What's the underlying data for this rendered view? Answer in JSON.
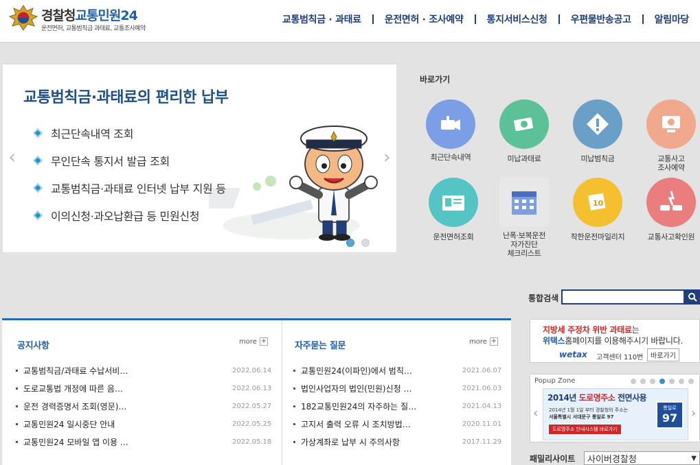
{
  "header": {
    "logo_title_a": "경찰청",
    "logo_title_b": "교통민원24",
    "logo_sub": "운전면허, 교통범칙금 과태료, 교통조사예약",
    "nav": [
      "교통범칙금 · 과태료",
      "운전면허 · 조사예약",
      "통지서비스신청",
      "우편물반송공고",
      "알림마당"
    ]
  },
  "slider": {
    "title": "교통범칙금·과태료의 편리한 납부",
    "items": [
      "최근단속내역 조회",
      "무인단속 통지서 발급 조회",
      "교통범칙금·과태료 인터넷 납부 지원 등",
      "이의신청·과오납환급 등 민원신청"
    ],
    "prev": "‹",
    "next": "›",
    "active_slide": 1,
    "slide_count": 2
  },
  "quick": {
    "title": "바로가기",
    "row1": [
      {
        "label": "최근단속내역",
        "color": "#7b9ee6",
        "icon": "camera-icon"
      },
      {
        "label": "미납과태료",
        "color": "#5cc196",
        "icon": "money-icon"
      },
      {
        "label": "미납범칙금",
        "color": "#6aa0c8",
        "icon": "warning-icon"
      },
      {
        "label": "교통사고\n조사예약",
        "color": "#f0a98c",
        "icon": "monitor-icon"
      }
    ],
    "row2": [
      {
        "label": "운전면허조회",
        "color": "#55c4c4",
        "icon": "license-icon"
      },
      {
        "label": "난폭·보복운전\n자가진단\n체크리스트",
        "color": "#7e9ee0",
        "icon": "calendar-icon"
      },
      {
        "label": "착한운전마일리지",
        "color": "#f5c030",
        "icon": "mileage-icon"
      },
      {
        "label": "교통사고확인원",
        "color": "#ea7e7e",
        "icon": "crash-icon"
      }
    ]
  },
  "search": {
    "label": "통합검색",
    "value": ""
  },
  "notice": {
    "title": "공지사항",
    "more": "more",
    "rows": [
      {
        "subject": "교통범칙금/과태료 수납서비…",
        "date": "2022.06.14"
      },
      {
        "subject": "도로교통법 개정에 따른 음…",
        "date": "2022.06.13"
      },
      {
        "subject": "운전 경력증명서 조회(영문)…",
        "date": "2022.05.27"
      },
      {
        "subject": "교통민원24 일시중단 안내",
        "date": "2022.05.25"
      },
      {
        "subject": "교통민원24 모바일 앱 이용 …",
        "date": "2022.05.18"
      }
    ]
  },
  "faq": {
    "title": "자주묻는 질문",
    "more": "more",
    "rows": [
      {
        "subject": "교통민원24(이파인)에서 범칙…",
        "date": "2021.06.07"
      },
      {
        "subject": "법인사업자의 법인(민원)신청 …",
        "date": "2021.06.03"
      },
      {
        "subject": "182교통민원24의 자주하는 질…",
        "date": "2021.04.13"
      },
      {
        "subject": "고지서 출력 오류 시 조치방법…",
        "date": "2020.11.01"
      },
      {
        "subject": "가상계좌로 납부 시 주의사항",
        "date": "2017.11.29"
      }
    ]
  },
  "wetax": {
    "line1a": "지방세 주정차 위반 과태료",
    "line1b": "는",
    "line2a": "위택스",
    "line2b": "홈페이지를 이용해주시기 바랍니다.",
    "logo": "wetax",
    "center": "고객센터 110번",
    "shortcut": "바로가기"
  },
  "popup": {
    "title": "Popup Zone",
    "active": 4,
    "count": 7,
    "banner_title_a": "2014년 ",
    "banner_title_b": "도로명주소",
    "banner_title_c": " 전면사용",
    "line1": "2014년 1월 1일 부터 경찰청의 주소는",
    "line2": "서울특별시 서대문구 통일로 97",
    "btn": "도로명주소 안내시스템 바로가기",
    "sign_top": "통일로",
    "sign_num": "97"
  },
  "family": {
    "label": "패밀리사이트",
    "selected": "사이버경찰청"
  }
}
